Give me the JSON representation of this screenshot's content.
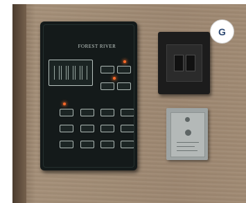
{
  "photo": {
    "badge_label": "G",
    "panel_brand": "FOREST RIVER"
  },
  "colors": {
    "wall": "#a08b74",
    "panel": "#141a1a",
    "led": "#ff6a2a",
    "badge_text": "#2e4a73"
  }
}
